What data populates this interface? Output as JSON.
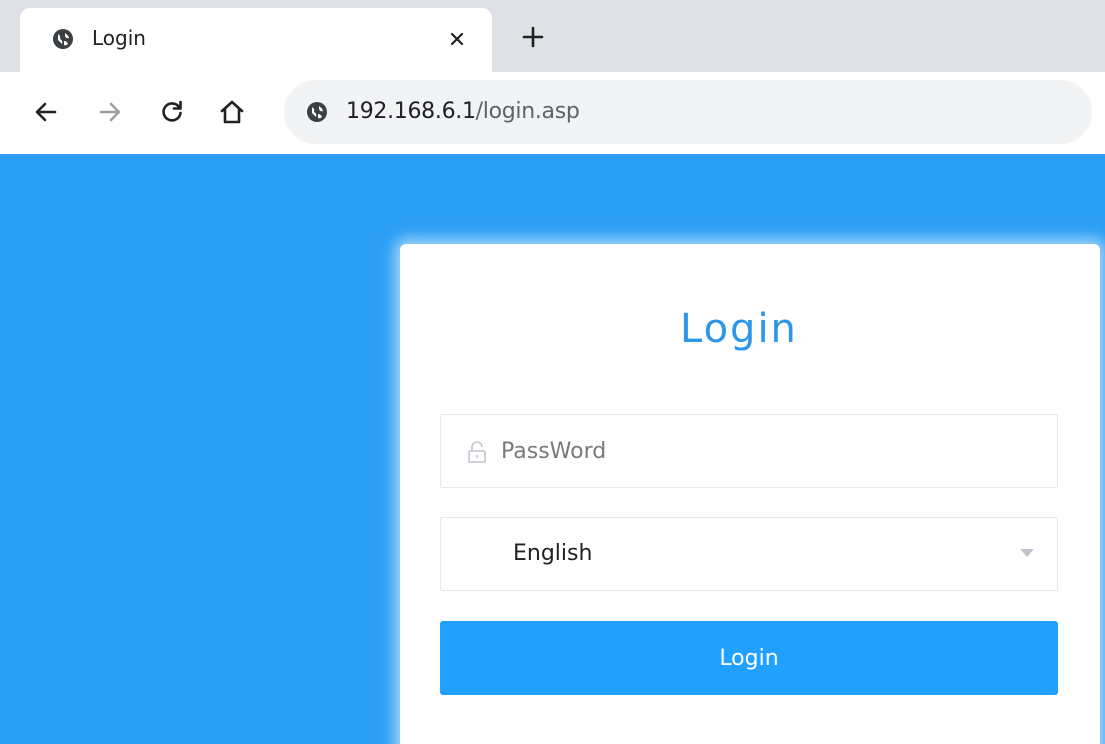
{
  "browser": {
    "tab": {
      "title": "Login",
      "favicon": "globe-icon"
    },
    "new_tab_icon": "plus-icon",
    "close_icon": "close-icon",
    "nav": {
      "back": "arrow-left-icon",
      "forward": "arrow-right-icon",
      "reload": "reload-icon",
      "home": "home-icon"
    },
    "address": {
      "host": "192.168.6.1",
      "path": "/login.asp",
      "icon": "globe-icon"
    }
  },
  "login": {
    "title": "Login",
    "password_placeholder": "PassWord",
    "password_icon": "lock-icon",
    "language": {
      "selected": "English",
      "icon": "caret-down-icon"
    },
    "submit_label": "Login"
  },
  "colors": {
    "page_background": "#2b9ff5",
    "title": "#2d96e8",
    "button": "#20a0ff",
    "tabstrip": "#dee1e6",
    "omnibox": "#f1f3f4"
  }
}
